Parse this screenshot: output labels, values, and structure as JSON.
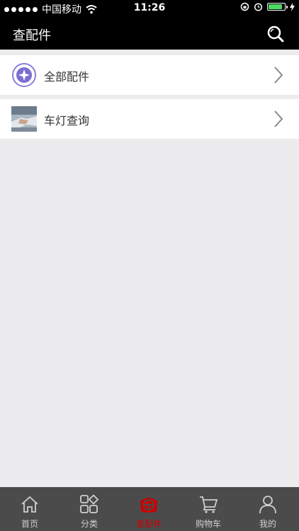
{
  "status_bar": {
    "carrier": "中国移动",
    "time": "11:26",
    "battery_level": 0.85
  },
  "nav": {
    "title": "查配件",
    "icon": "search-icon"
  },
  "items": [
    {
      "label": "全部配件",
      "icon": "compass-icon"
    },
    {
      "label": "车灯查询",
      "icon": "handshake-photo-icon"
    }
  ],
  "tabs": [
    {
      "label": "首页",
      "icon": "home-icon",
      "active": false
    },
    {
      "label": "分类",
      "icon": "grid-icon",
      "active": false
    },
    {
      "label": "查配件",
      "icon": "steering-wheel-icon",
      "active": true
    },
    {
      "label": "购物车",
      "icon": "cart-icon",
      "active": false
    },
    {
      "label": "我的",
      "icon": "profile-icon",
      "active": false
    }
  ],
  "colors": {
    "bar_bg": "#000000",
    "tab_bg": "#4b4b4b",
    "active_tab": "#cc0000",
    "battery": "#4cd964"
  }
}
